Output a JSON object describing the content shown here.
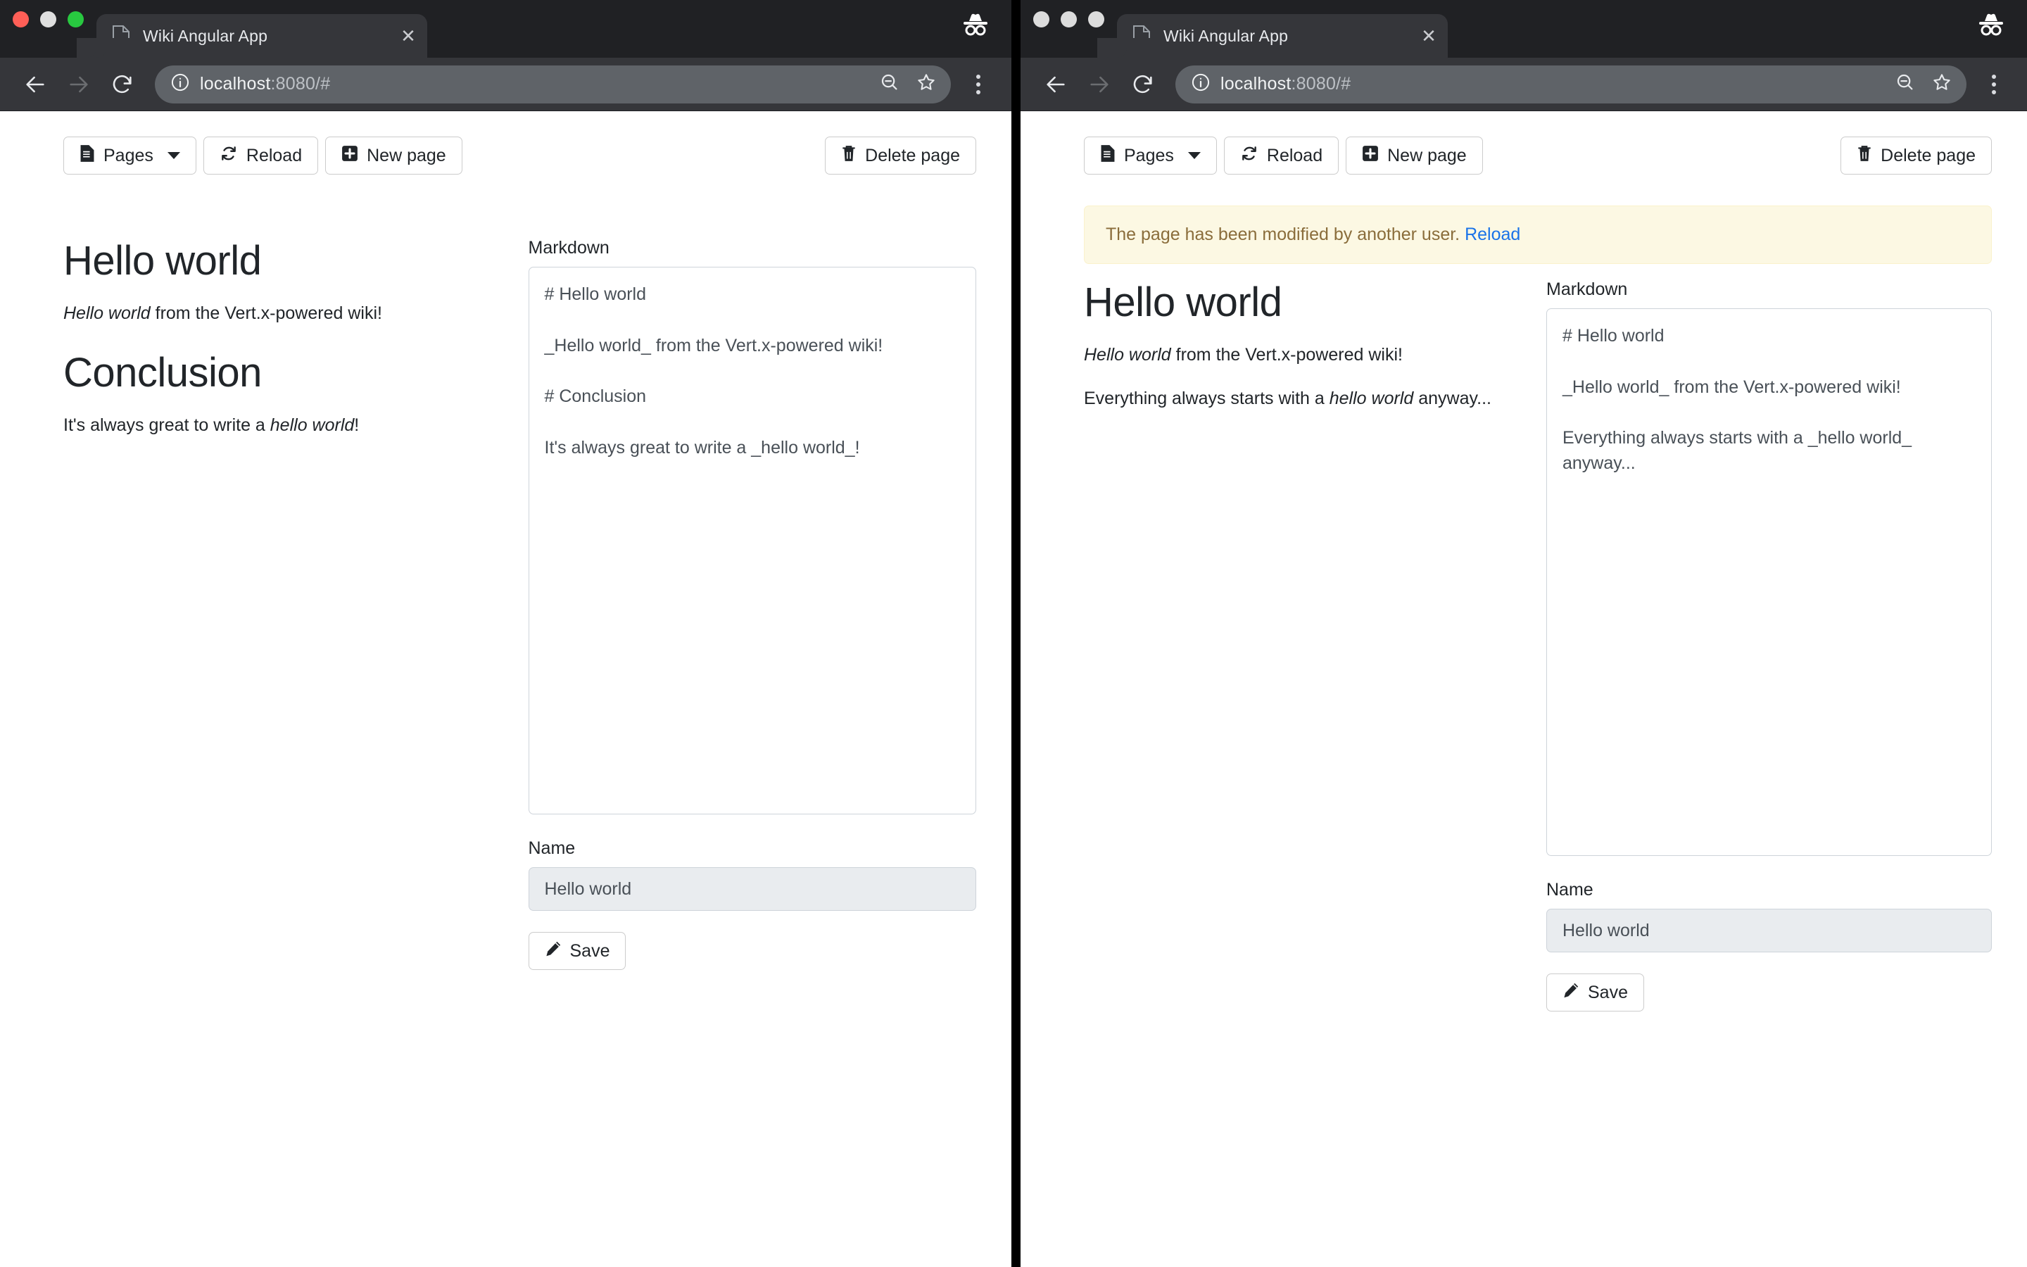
{
  "browser": {
    "tab": {
      "title": "Wiki Angular App",
      "favicon_icon": "document-icon",
      "close_icon": "close-icon"
    },
    "new_tab_icon": "new-tab-icon",
    "incognito_icon": "incognito-icon",
    "nav": {
      "back_icon": "back-arrow-icon",
      "forward_icon": "forward-arrow-icon",
      "reload_icon": "reload-icon",
      "info_icon": "info-circle-icon",
      "zoom_icon": "zoom-out-icon",
      "bookmark_icon": "star-icon",
      "menu_icon": "kebab-menu-icon"
    },
    "address": {
      "host": "localhost",
      "rest": ":8080/#"
    }
  },
  "colors": {
    "chrome_dark": "#202124",
    "chrome_tab": "#35363a",
    "omnibox": "#5f6368",
    "link_blue": "#1a73e8",
    "alert_bg": "#fcf8e3",
    "alert_text": "#8a6d3b",
    "input_disabled_bg": "#e9ecef",
    "border": "#ced4da"
  },
  "toolbar": {
    "pages_label": "Pages",
    "pages_icon": "file-text-icon",
    "reload_label": "Reload",
    "reload_icon": "refresh-icon",
    "new_page_label": "New page",
    "new_page_icon": "plus-square-icon",
    "delete_page_label": "Delete page",
    "delete_page_icon": "trash-icon",
    "caret_icon": "chevron-down-icon"
  },
  "form": {
    "markdown_label": "Markdown",
    "name_label": "Name",
    "name_value": "Hello world",
    "save_label": "Save",
    "save_icon": "pencil-icon",
    "resize_icon": "resize-grip-icon"
  },
  "left_window": {
    "article": {
      "title": "Hello world",
      "intro_em": "Hello world",
      "intro_rest": " from the Vert.x-powered wiki!",
      "section_title": "Conclusion",
      "outro_pre": "It's always great to write a ",
      "outro_em": "hello world",
      "outro_post": "!"
    },
    "markdown": "# Hello world\n\n_Hello world_ from the Vert.x-powered wiki!\n\n# Conclusion\n\nIt's always great to write a _hello world_!"
  },
  "right_window": {
    "alert": {
      "message": "The page has been modified by another user. ",
      "link_label": "Reload"
    },
    "article": {
      "title": "Hello world",
      "intro_em": "Hello world",
      "intro_rest": " from the Vert.x-powered wiki!",
      "outro_pre": "Everything always starts with a ",
      "outro_em": "hello world",
      "outro_post": " anyway..."
    },
    "markdown": "# Hello world\n\n_Hello world_ from the Vert.x-powered wiki!\n\nEverything always starts with a _hello world_ anyway..."
  }
}
